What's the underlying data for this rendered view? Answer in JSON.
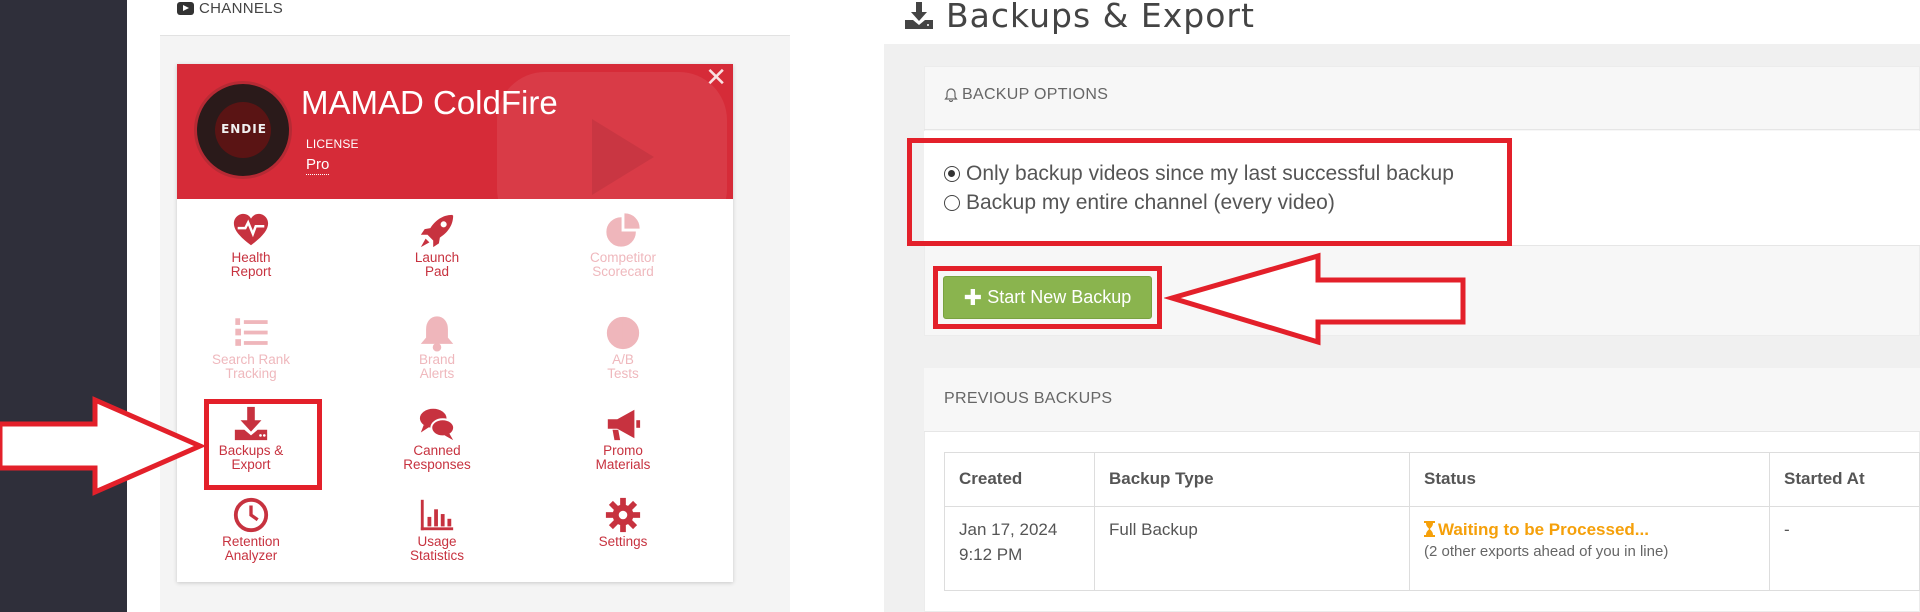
{
  "left": {
    "channels_label": "CHANNELS",
    "channel": {
      "name": "MAMAD ColdFire",
      "license_label": "LICENSE",
      "license_value": "Pro",
      "avatar_text": "ENDIE"
    },
    "tools": [
      {
        "label": "Health\nReport",
        "icon": "heartbeat-icon",
        "enabled": true
      },
      {
        "label": "Launch\nPad",
        "icon": "rocket-icon",
        "enabled": true
      },
      {
        "label": "Competitor\nScorecard",
        "icon": "pie-chart-icon",
        "enabled": false
      },
      {
        "label": "Search Rank\nTracking",
        "icon": "ordered-list-icon",
        "enabled": false
      },
      {
        "label": "Brand\nAlerts",
        "icon": "bell-icon",
        "enabled": false
      },
      {
        "label": "A/B\nTests",
        "icon": "half-circle-icon",
        "enabled": false
      },
      {
        "label": "Backups &\nExport",
        "icon": "download-icon",
        "enabled": true
      },
      {
        "label": "Canned\nResponses",
        "icon": "comments-icon",
        "enabled": true
      },
      {
        "label": "Promo\nMaterials",
        "icon": "megaphone-icon",
        "enabled": true
      },
      {
        "label": "Retention\nAnalyzer",
        "icon": "clock-icon",
        "enabled": true
      },
      {
        "label": "Usage\nStatistics",
        "icon": "bar-chart-icon",
        "enabled": true
      },
      {
        "label": "Settings",
        "icon": "gear-icon",
        "enabled": true
      }
    ]
  },
  "right": {
    "title": "Backups & Export",
    "backup_options": {
      "heading": "BACKUP OPTIONS",
      "options": [
        {
          "label": "Only backup videos since my last successful backup",
          "selected": true
        },
        {
          "label": "Backup my entire channel (every video)",
          "selected": false
        }
      ],
      "start_button": "Start New Backup"
    },
    "previous_backups": {
      "heading": "PREVIOUS BACKUPS",
      "columns": [
        "Created",
        "Backup Type",
        "Status",
        "Started At"
      ],
      "rows": [
        {
          "created_date": "Jan 17, 2024",
          "created_time": "9:12 PM",
          "type": "Full Backup",
          "status": "Waiting to be Processed...",
          "status_note": "(2 other exports ahead of you in line)",
          "started_at": "-"
        }
      ]
    }
  },
  "colors": {
    "brand_red": "#d62b38",
    "tool_red": "#c7323f",
    "annotation_red": "#e3202a",
    "button_green": "#8ab44e",
    "status_orange": "#f5a00a"
  }
}
